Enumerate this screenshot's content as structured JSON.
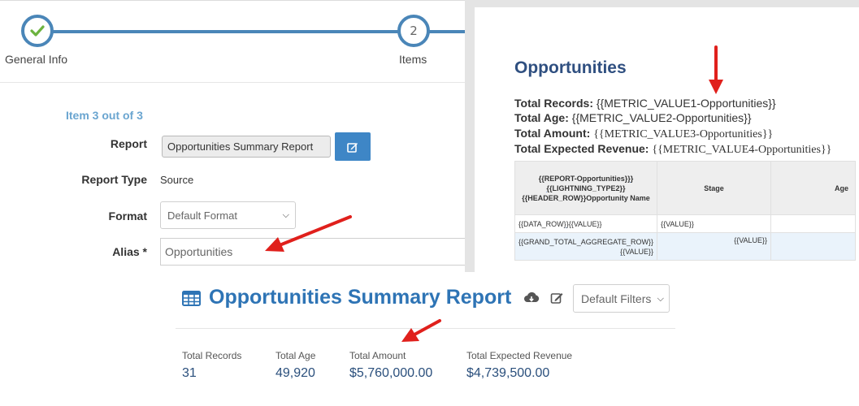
{
  "wizard": {
    "steps": [
      {
        "label": "General Info",
        "number": "",
        "completed": true
      },
      {
        "label": "Items",
        "number": "2",
        "completed": false
      }
    ],
    "item_count": "Item 3 out of 3",
    "fields": {
      "report_label": "Report",
      "report_value": "Opportunities Summary Report",
      "report_type_label": "Report Type",
      "report_type_value": "Source",
      "format_label": "Format",
      "format_value": "Default Format",
      "alias_label": "Alias *",
      "alias_value": "Opportunities"
    },
    "accent_color": "#4a86b8"
  },
  "template": {
    "title": "Opportunities",
    "metrics": [
      {
        "label": "Total Records:",
        "value": "{{METRIC_VALUE1-Opportunities}}"
      },
      {
        "label": "Total Age:",
        "value": "{{METRIC_VALUE2-Opportunities}}"
      },
      {
        "label": "Total Amount:",
        "value": "{{METRIC_VALUE3-Opportunities}}"
      },
      {
        "label": "Total Expected Revenue:",
        "value": "{{METRIC_VALUE4-Opportunities}}"
      }
    ],
    "table": {
      "header_name_a": "{{REPORT-Opportunities}}",
      "header_name_dots": "}{",
      "header_name_b": "{LIGHTNING_TYPE2}}{{HEADER_ROW}}Opportunity Name",
      "header_stage": "Stage",
      "header_age": "Age",
      "data_row_a": "{{DATA_ROW}",
      "data_row_dots": "}{",
      "data_row_b": "{VALUE}}",
      "data_stage": "{{VALUE}}",
      "total_row_a": "{{GRAND_TOTAL_AGGREGATE_ROW",
      "total_row_dots": "}}{",
      "total_row_b": "{VALUE}}",
      "total_stage": "{{VALUE}}"
    }
  },
  "report": {
    "title": "Opportunities Summary Report",
    "filters_value": "Default Filters",
    "icons": [
      "table-icon",
      "cloud-download-icon",
      "edit-icon"
    ],
    "stats": [
      {
        "label": "Total Records",
        "value": "31"
      },
      {
        "label": "Total Age",
        "value": "49,920"
      },
      {
        "label": "Total Amount",
        "value": "$5,760,000.00"
      },
      {
        "label": "Total Expected Revenue",
        "value": "$4,739,500.00"
      }
    ]
  },
  "annotation_color": "#e0201c"
}
